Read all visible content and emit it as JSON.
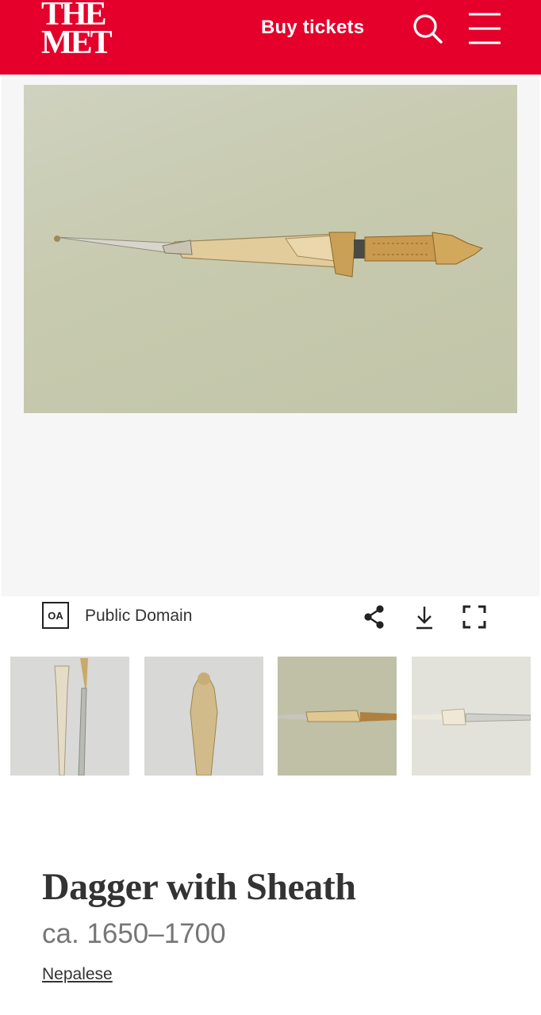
{
  "header": {
    "logo_line1": "THE",
    "logo_line2": "MET",
    "buy_tickets_label": "Buy tickets",
    "search_icon": "search-icon",
    "menu_icon": "hamburger-menu-icon",
    "brand_color": "#e4002b"
  },
  "artwork_image": {
    "subject": "dagger-with-sheath-on-gray-background"
  },
  "rights": {
    "badge_text": "OA",
    "label": "Public Domain"
  },
  "actions": [
    {
      "icon": "share-icon"
    },
    {
      "icon": "download-icon"
    },
    {
      "icon": "fullscreen-icon"
    }
  ],
  "thumbnails": [
    {
      "subject": "dagger-and-sheath-vertical"
    },
    {
      "subject": "hilt-detail-figure"
    },
    {
      "subject": "dagger-in-sheath-horizontal"
    },
    {
      "subject": "sheath-detail"
    }
  ],
  "artwork": {
    "title": "Dagger with Sheath",
    "date": "ca. 1650–1700",
    "culture": "Nepalese"
  }
}
